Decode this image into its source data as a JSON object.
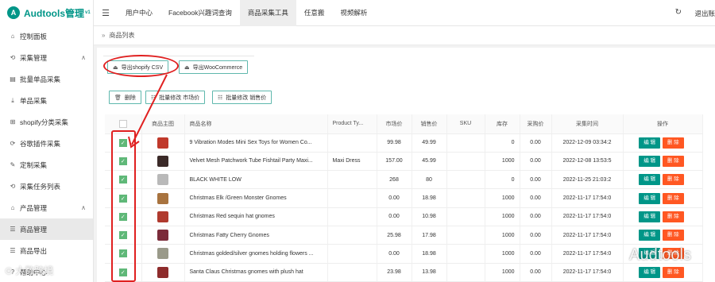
{
  "brand": {
    "logo_letter": "A",
    "name": "Audtools管理",
    "version": "v1"
  },
  "sidebar": {
    "items": [
      {
        "label": "控制面板",
        "icon": "home-icon",
        "glyph": "⌂",
        "caret": ""
      },
      {
        "label": "采集管理",
        "icon": "sync-icon",
        "glyph": "⟲",
        "caret": "∧"
      },
      {
        "label": "批量单品采集",
        "icon": "layers-icon",
        "glyph": "▤",
        "caret": ""
      },
      {
        "label": "单品采集",
        "icon": "download-icon",
        "glyph": "⤓",
        "caret": ""
      },
      {
        "label": "shopify分类采集",
        "icon": "grid-icon",
        "glyph": "⊞",
        "caret": ""
      },
      {
        "label": "谷歌插件采集",
        "icon": "sync-icon",
        "glyph": "⟳",
        "caret": ""
      },
      {
        "label": "定制采集",
        "icon": "edit-icon",
        "glyph": "✎",
        "caret": ""
      },
      {
        "label": "采集任务列表",
        "icon": "sync-icon",
        "glyph": "⟲",
        "caret": ""
      },
      {
        "label": "产品管理",
        "icon": "home-icon",
        "glyph": "⌂",
        "caret": "∧"
      },
      {
        "label": "商品管理",
        "icon": "database-icon",
        "glyph": "☰",
        "caret": "",
        "active": true
      },
      {
        "label": "商品导出",
        "icon": "database-icon",
        "glyph": "☰",
        "caret": ""
      },
      {
        "label": "帮助中心",
        "icon": "help-icon",
        "glyph": "?",
        "caret": ""
      }
    ]
  },
  "topbar": {
    "tabs": [
      {
        "label": "用户中心",
        "active": false
      },
      {
        "label": "Facebook兴趣词查询",
        "active": false
      },
      {
        "label": "商品采集工具",
        "active": true
      },
      {
        "label": "任意搬",
        "active": false
      },
      {
        "label": "视频解析",
        "active": false
      }
    ],
    "logout_label": "退出账"
  },
  "breadcrumb": {
    "label": "商品列表",
    "sep": "»"
  },
  "export": {
    "shopify": "导出shopify CSV",
    "woocommerce": "导出WooCommerce"
  },
  "actions": {
    "delete": "删除",
    "batch_market": "批量修改 市场价",
    "batch_sale": "批量修改 销售价"
  },
  "table": {
    "headers": [
      "",
      "商品主图",
      "商品名称",
      "Product Ty...",
      "市场价",
      "销售价",
      "SKU",
      "库存",
      "采购价",
      "采集时间",
      "操作"
    ],
    "edit_label": "编 辑",
    "delete_label": "删 除",
    "rows": [
      {
        "thumb": "#c0392b",
        "name": "9 Vibration Modes Mini Sex Toys for Women Co...",
        "type": "",
        "market": "99.98",
        "sale": "49.99",
        "sku": "",
        "stock": "0",
        "purchase": "0.00",
        "time": "2022-12-09 03:34:2"
      },
      {
        "thumb": "#3b2a28",
        "name": "Velvet Mesh Patchwork Tube Fishtail Party Maxi...",
        "type": "Maxi Dress",
        "market": "157.00",
        "sale": "45.99",
        "sku": "",
        "stock": "1000",
        "purchase": "0.00",
        "time": "2022-12-08 13:53:5"
      },
      {
        "thumb": "#b9b9b9",
        "name": "BLACK WHITE LOW",
        "type": "",
        "market": "268",
        "sale": "80",
        "sku": "",
        "stock": "0",
        "purchase": "0.00",
        "time": "2022-11-25 21:03:2"
      },
      {
        "thumb": "#a8733f",
        "name": "Christmas Elk /Green Monster Gnomes",
        "type": "",
        "market": "0.00",
        "sale": "18.98",
        "sku": "",
        "stock": "1000",
        "purchase": "0.00",
        "time": "2022-11-17 17:54:0"
      },
      {
        "thumb": "#b03a2e",
        "name": "Christmas Red sequin hat gnomes",
        "type": "",
        "market": "0.00",
        "sale": "10.98",
        "sku": "",
        "stock": "1000",
        "purchase": "0.00",
        "time": "2022-11-17 17:54:0"
      },
      {
        "thumb": "#7b2b3a",
        "name": "Christmas Fatty Cherry Gnomes",
        "type": "",
        "market": "25.98",
        "sale": "17.98",
        "sku": "",
        "stock": "1000",
        "purchase": "0.00",
        "time": "2022-11-17 17:54:0"
      },
      {
        "thumb": "#9a9a8a",
        "name": "Christmas golded/silver gnomes holding flowers ...",
        "type": "",
        "market": "0.00",
        "sale": "18.98",
        "sku": "",
        "stock": "1000",
        "purchase": "0.00",
        "time": "2022-11-17 17:54:0"
      },
      {
        "thumb": "#8e2c2c",
        "name": "Santa Claus Christmas gnomes with plush hat",
        "type": "",
        "market": "23.98",
        "sale": "13.98",
        "sku": "",
        "stock": "1000",
        "purchase": "0.00",
        "time": "2022-11-17 17:54:0"
      }
    ]
  },
  "watermark": {
    "left": "⊙ 大数跨境",
    "right": "Audtools"
  },
  "colors": {
    "brand": "#009688",
    "edit": "#009688",
    "delete": "#ff5722",
    "checkbox": "#5fb878",
    "annotation": "#e02020"
  }
}
